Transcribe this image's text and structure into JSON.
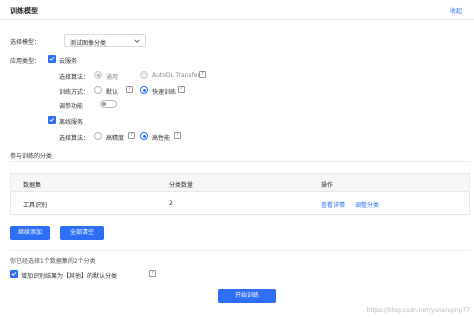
{
  "header": {
    "title": "训练模型",
    "collapse_label": "收起"
  },
  "model_select": {
    "label": "选择模型：",
    "value": "测试图像分类"
  },
  "app_type": {
    "label": "应用类型：",
    "cloud": {
      "label": "云服务",
      "algorithm_label": "选择算法：",
      "algorithm_options": [
        "通用",
        "AutoDL Transfer"
      ],
      "method_label": "训练方式：",
      "method_options": [
        "默认",
        "快速训练"
      ],
      "tuning_label": "调参功能"
    },
    "offline": {
      "label": "离线服务",
      "algorithm_label": "选择算法：",
      "algorithm_options": [
        "高精度",
        "高性能"
      ]
    }
  },
  "classes_section": {
    "label": "参与训练的分类"
  },
  "table": {
    "headers": [
      "数据集",
      "分类数量",
      "操作"
    ],
    "rows": [
      {
        "dataset": "工具识别",
        "count": "2",
        "actions": [
          "查看详情",
          "调整分类"
        ]
      }
    ]
  },
  "buttons": {
    "add_more": "继续添加",
    "clear_all": "全部清空",
    "start": "开始训练"
  },
  "summary": "你已经选择1个数据集的2个分类",
  "other_option": {
    "label": "增加识别结果为【其他】的默认分类"
  },
  "watermark": "https://blog.csdn.net/yunenging77"
}
